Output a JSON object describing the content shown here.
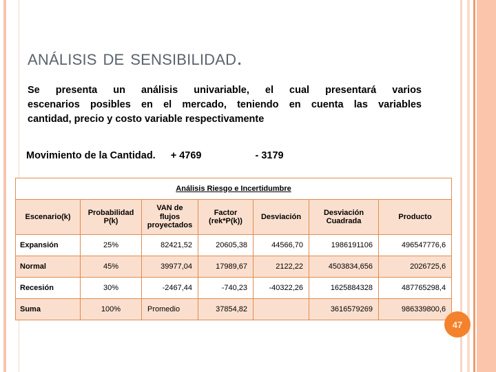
{
  "slide": {
    "title": "Análisis de Sensibilidad.",
    "page_number": "47",
    "accent_color": "#f4812c",
    "stripe_color": "#fac5ab",
    "title_color": "#5b636e"
  },
  "paragraph": {
    "line1": "Se presenta un análisis univariable, el cual presentará varios",
    "line2": "escenarios posibles en el mercado, teniendo en cuenta las variables",
    "line3": "cantidad, precio y costo variable respectivamente"
  },
  "movimiento": {
    "label": "Movimiento de la Cantidad.",
    "up": "+ 4769",
    "down": "- 3179"
  },
  "table": {
    "caption": "Análisis Riesgo e Incertidumbre",
    "headers": [
      "Escenario(k)",
      "Probabilidad P(k)",
      "VAN de flujos proyectados",
      "Factor (rek*P(k))",
      "Desviación",
      "Desviación Cuadrada",
      "Producto"
    ],
    "headers_multiline": {
      "h0_l1": "Escenario(k)",
      "h1_l1": "Probabilidad",
      "h1_l2": "P(k)",
      "h2_l1": "VAN de",
      "h2_l2": "flujos",
      "h2_l3": "proyectados",
      "h3_l1": "Factor",
      "h3_l2": "(rek*P(k))",
      "h4_l1": "Desviación",
      "h5_l1": "Desviación",
      "h5_l2": "Cuadrada",
      "h6_l1": "Producto"
    },
    "rows": [
      {
        "escenario": "Expansión",
        "probabilidad": "25%",
        "van": "82421,52",
        "factor": "20605,38",
        "desviacion": "44566,70",
        "desviacion_cuadrada": "1986191106",
        "producto": "496547776,6"
      },
      {
        "escenario": "Normal",
        "probabilidad": "45%",
        "van": "39977,04",
        "factor": "17989,67",
        "desviacion": "2122,22",
        "desviacion_cuadrada": "4503834,656",
        "producto": "2026725,6"
      },
      {
        "escenario": "Recesión",
        "probabilidad": "30%",
        "van": "-2467,44",
        "factor": "-740,23",
        "desviacion": "-40322,26",
        "desviacion_cuadrada": "1625884328",
        "producto": "487765298,4"
      },
      {
        "escenario": "Suma",
        "probabilidad": "100%",
        "van": "Promedio",
        "factor": "37854,82",
        "desviacion": "",
        "desviacion_cuadrada": "3616579269",
        "producto": "986339800,6"
      }
    ]
  }
}
